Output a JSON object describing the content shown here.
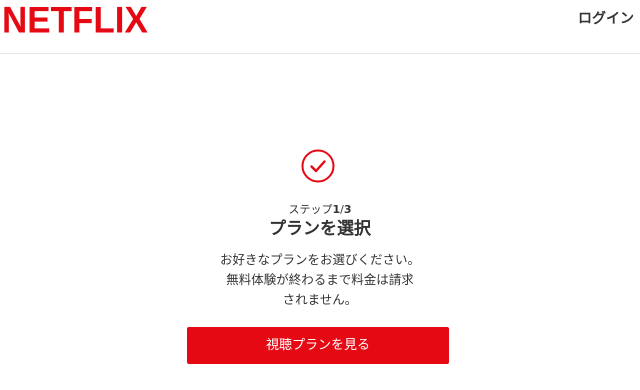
{
  "header": {
    "logo_text": "NETFLIX",
    "login_label": "ログイン"
  },
  "step": {
    "prefix": "ステップ",
    "current": "1",
    "separator": "/",
    "total": "3"
  },
  "main": {
    "icon": "check-circle-icon",
    "title": "プランを選択",
    "description_lines": [
      "お好きなプランをお選びください。",
      "無料体験が終わるまで料金は請求",
      "されません。"
    ],
    "cta_label": "視聴プランを見る"
  },
  "colors": {
    "brand": "#e50914",
    "text": "#333333",
    "background": "#ffffff"
  }
}
